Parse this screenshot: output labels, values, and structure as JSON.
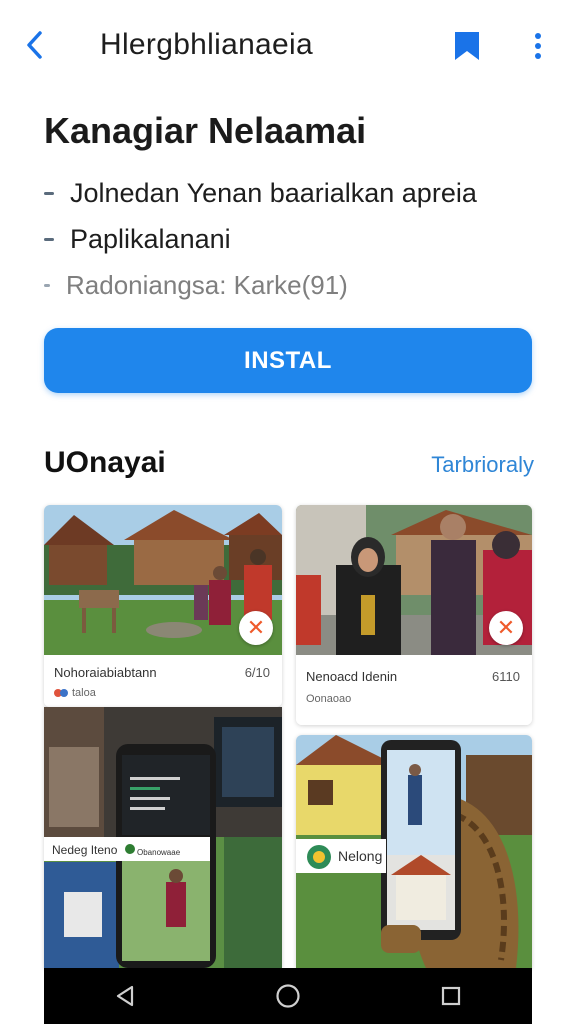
{
  "topbar": {
    "title": "Hlergbhlianaeia",
    "back_icon": "chevron-left-icon",
    "bookmark_icon": "bookmark-icon",
    "more_icon": "more-vertical-icon",
    "accent": "#1a73e8"
  },
  "app": {
    "heading": "Kanagiar Nelaamai",
    "bullets": [
      "Jolnedan Yenan baarialkan apreia",
      "Paplikalanani",
      "Radoniangsa: Karke(91)"
    ]
  },
  "install_button": {
    "label": "INSTAL",
    "color": "#1f86ec"
  },
  "section": {
    "title": "UOnayai",
    "link": "Tarbrioraly"
  },
  "cards": [
    {
      "title": "Nohoraiabiabtann",
      "number": "6/10",
      "sub": "taloa"
    },
    {
      "title": "Nenoacd Idenin",
      "number": "6110",
      "sub": "Oonaoao"
    },
    {
      "title": "Nedeg Iteno",
      "screen_label": "Obanowaae"
    },
    {
      "title": "Nelong"
    }
  ],
  "navbar": {
    "back": "triangle-back-icon",
    "home": "circle-home-icon",
    "recents": "square-recents-icon"
  }
}
